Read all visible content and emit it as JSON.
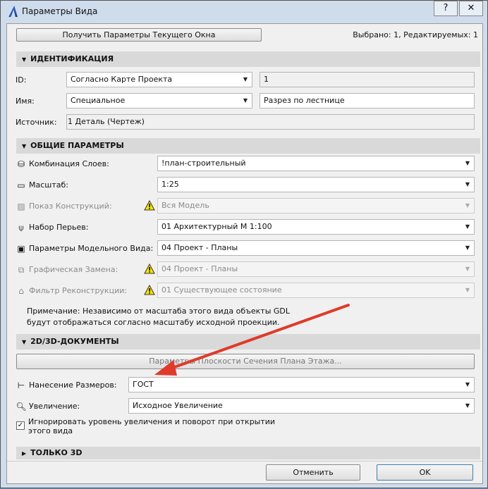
{
  "window": {
    "title": "Параметры Вида",
    "help": "?",
    "close": "✕"
  },
  "top": {
    "get_params_button": "Получить Параметры Текущего Окна",
    "selection_info": "Выбрано: 1, Редактируемых: 1"
  },
  "identification": {
    "header": "ИДЕНТИФИКАЦИЯ",
    "id_label": "ID:",
    "id_select": "Согласно Карте Проекта",
    "id_value": "1",
    "name_label": "Имя:",
    "name_select": "Специальное",
    "name_value": "Разрез по лестнице",
    "source_label": "Источник:",
    "source_value": "1 Деталь (Чертеж)"
  },
  "general": {
    "header": "ОБЩИЕ ПАРАМЕТРЫ",
    "rows": [
      {
        "label": "Комбинация Слоев:",
        "value": "!план-строительный",
        "icon": "layers-icon",
        "disabled": false
      },
      {
        "label": "Масштаб:",
        "value": "1:25",
        "icon": "ruler-icon",
        "disabled": false
      },
      {
        "label": "Показ Конструкций:",
        "value": "Вся Модель",
        "icon": "structure-icon",
        "disabled": true
      },
      {
        "label": "Набор Перьев:",
        "value": "01 Архитектурный М 1:100",
        "icon": "pen-icon",
        "disabled": false
      },
      {
        "label": "Параметры Модельного Вида:",
        "value": "04 Проект - Планы",
        "icon": "model-view-icon",
        "disabled": false
      },
      {
        "label": "Графическая Замена:",
        "value": "04 Проект - Планы",
        "icon": "graphic-override-icon",
        "disabled": true
      },
      {
        "label": "Фильтр Реконструкции:",
        "value": "01 Существующее состояние",
        "icon": "renovation-icon",
        "disabled": true
      }
    ],
    "note": "Примечание: Независимо от масштаба этого вида объекты GDL будут отображаться согласно масштабу исходной проекции."
  },
  "docs": {
    "header": "2D/3D-ДОКУМЕНТЫ",
    "section_plane_button": "Параметры Плоскости Сечения Плана Этажа...",
    "dims_label": "Нанесение Размеров:",
    "dims_value": "ГОСТ",
    "zoom_label": "Увеличение:",
    "zoom_value": "Исходное Увеличение",
    "ignore_zoom_label": "Игнорировать уровень увеличения и поворот при открытии этого вида",
    "ignore_zoom_checked": true
  },
  "only3d": {
    "header": "ТОЛЬКО 3D"
  },
  "footer": {
    "cancel": "Отменить",
    "ok": "OK"
  },
  "colors": {
    "arrow": "#e03a2a",
    "ok_border": "#3c7fb1"
  }
}
